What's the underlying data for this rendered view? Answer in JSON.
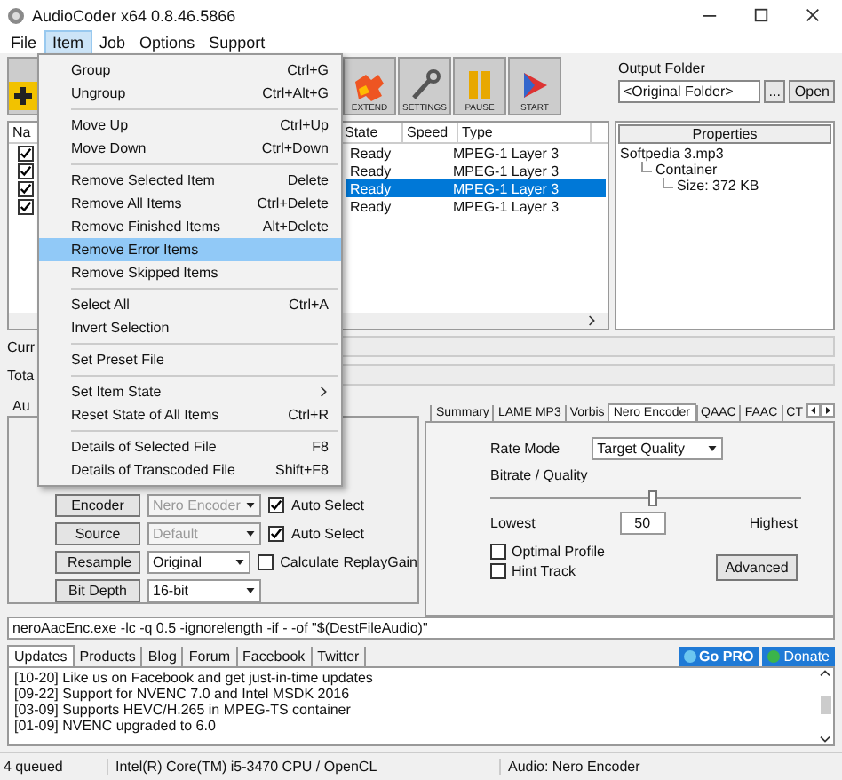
{
  "window": {
    "title": "AudioCoder x64 0.8.46.5866"
  },
  "menu_bar": [
    {
      "label": "File",
      "selected": false
    },
    {
      "label": "Item",
      "selected": true
    },
    {
      "label": "Job",
      "selected": false
    },
    {
      "label": "Options",
      "selected": false
    },
    {
      "label": "Support",
      "selected": false
    }
  ],
  "item_menu": [
    {
      "kind": "item",
      "label": "Group",
      "shortcut": "Ctrl+G",
      "selected": false
    },
    {
      "kind": "item",
      "label": "Ungroup",
      "shortcut": "Ctrl+Alt+G",
      "selected": false
    },
    {
      "kind": "separator"
    },
    {
      "kind": "item",
      "label": "Move Up",
      "shortcut": "Ctrl+Up",
      "selected": false
    },
    {
      "kind": "item",
      "label": "Move Down",
      "shortcut": "Ctrl+Down",
      "selected": false
    },
    {
      "kind": "separator"
    },
    {
      "kind": "item",
      "label": "Remove Selected Item",
      "shortcut": "Delete",
      "selected": false
    },
    {
      "kind": "item",
      "label": "Remove All Items",
      "shortcut": "Ctrl+Delete",
      "selected": false
    },
    {
      "kind": "item",
      "label": "Remove Finished Items",
      "shortcut": "Alt+Delete",
      "selected": false
    },
    {
      "kind": "item",
      "label": "Remove Error Items",
      "selected": true
    },
    {
      "kind": "item",
      "label": "Remove Skipped Items",
      "selected": false
    },
    {
      "kind": "separator"
    },
    {
      "kind": "item",
      "label": "Select All",
      "shortcut": "Ctrl+A",
      "selected": false
    },
    {
      "kind": "item",
      "label": "Invert Selection",
      "selected": false
    },
    {
      "kind": "separator"
    },
    {
      "kind": "item",
      "label": "Set Preset File",
      "selected": false
    },
    {
      "kind": "separator"
    },
    {
      "kind": "submenu",
      "label": "Set Item State",
      "selected": false
    },
    {
      "kind": "item",
      "label": "Reset State of All Items",
      "shortcut": "Ctrl+R",
      "selected": false
    },
    {
      "kind": "separator"
    },
    {
      "kind": "item",
      "label": "Details of Selected File",
      "shortcut": "F8",
      "selected": false
    },
    {
      "kind": "item",
      "label": "Details of Transcoded File",
      "shortcut": "Shift+F8",
      "selected": false
    }
  ],
  "toolbar": [
    {
      "kind": "add"
    },
    {
      "kind": "extend",
      "label": "EXTEND"
    },
    {
      "kind": "settings",
      "label": "SETTINGS"
    },
    {
      "kind": "pause",
      "label": "PAUSE"
    },
    {
      "kind": "start",
      "label": "START"
    }
  ],
  "output_folder": {
    "label": "Output Folder",
    "value": "<Original Folder>",
    "browse": "...",
    "open": "Open"
  },
  "file_list": {
    "columns": [
      "Na",
      "State",
      "Speed",
      "Type"
    ],
    "rows": [
      {
        "checked": true,
        "state": "Ready",
        "type": "MPEG-1 Layer 3",
        "selected": false
      },
      {
        "checked": true,
        "state": "Ready",
        "type": "MPEG-1 Layer 3",
        "selected": false
      },
      {
        "checked": true,
        "state": "Ready",
        "type": "MPEG-1 Layer 3",
        "selected": true
      },
      {
        "checked": true,
        "state": "Ready",
        "type": "MPEG-1 Layer 3",
        "selected": false
      }
    ]
  },
  "properties": {
    "title": "Properties",
    "tree": [
      {
        "label": "Softpedia 3.mp3",
        "children": [
          {
            "label": "Container",
            "children": [
              {
                "label": "Size: 372 KB"
              }
            ]
          }
        ]
      }
    ]
  },
  "progress": [
    {
      "label": "Curr",
      "level": 0
    },
    {
      "label": "Tota",
      "level": 0
    }
  ],
  "left_tab": "Au",
  "encoder_rows": [
    {
      "button": "Encoder",
      "value": "Nero Encoder",
      "disabled": true,
      "check": {
        "label": "Auto Select",
        "checked": true
      }
    },
    {
      "button": "Source",
      "value": "Default",
      "disabled": true,
      "check": {
        "label": "Auto Select",
        "checked": true
      }
    },
    {
      "button": "Resample",
      "value": "Original",
      "disabled": false,
      "check": {
        "label": "Calculate ReplayGain",
        "checked": false
      }
    },
    {
      "button": "Bit Depth",
      "value": "16-bit",
      "disabled": false
    }
  ],
  "encoder_tabs": [
    {
      "label": "Summary",
      "selected": false
    },
    {
      "label": "LAME MP3",
      "selected": false
    },
    {
      "label": "Vorbis",
      "selected": false
    },
    {
      "label": "Nero Encoder",
      "selected": true
    },
    {
      "label": "QAAC",
      "selected": false
    },
    {
      "label": "FAAC",
      "selected": false
    },
    {
      "label": "CT",
      "selected": false
    }
  ],
  "nero": {
    "rate_mode_label": "Rate Mode",
    "rate_mode": "Target Quality",
    "bitrate_label": "Bitrate / Quality",
    "level": 0.51,
    "lowest": "Lowest",
    "value": "50",
    "highest": "Highest",
    "options": [
      {
        "label": "Optimal Profile",
        "checked": false
      },
      {
        "label": "Hint Track",
        "checked": false
      }
    ],
    "advanced": "Advanced"
  },
  "command_line": "neroAacEnc.exe -lc -q 0.5 -ignorelength -if - -of \"$(DestFileAudio)\"",
  "news_tabs": [
    {
      "label": "Updates",
      "selected": true
    },
    {
      "label": "Products",
      "selected": false
    },
    {
      "label": "Blog",
      "selected": false
    },
    {
      "label": "Forum",
      "selected": false
    },
    {
      "label": "Facebook",
      "selected": false
    },
    {
      "label": "Twitter",
      "selected": false
    }
  ],
  "go_pro": "Go PRO",
  "donate": "Donate",
  "news": [
    "[10-20] Like us on Facebook and get just-in-time updates",
    "[09-22] Support for NVENC 7.0 and Intel MSDK 2016",
    "[03-09] Supports HEVC/H.265 in MPEG-TS container",
    "[01-09] NVENC upgraded to 6.0"
  ],
  "status_bar": [
    "4 queued",
    "Intel(R) Core(TM) i5-3470 CPU  / OpenCL",
    "Audio: Nero Encoder"
  ]
}
